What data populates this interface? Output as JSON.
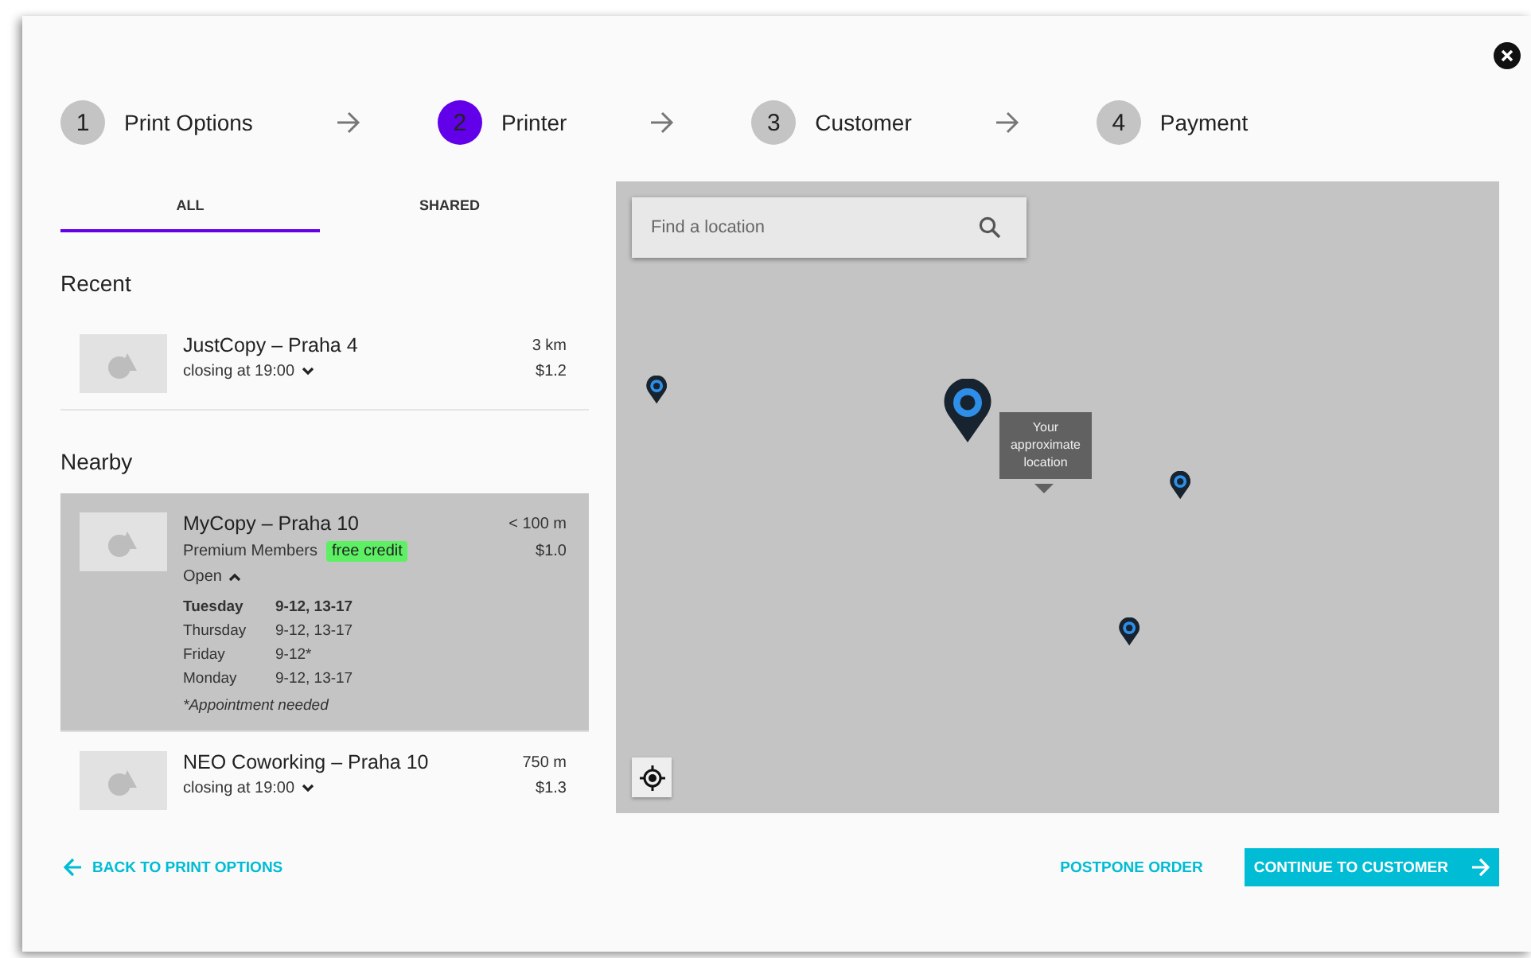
{
  "steps": [
    {
      "number": "1",
      "label": "Print Options",
      "selected": false
    },
    {
      "number": "2",
      "label": "Printer",
      "selected": true
    },
    {
      "number": "3",
      "label": "Customer",
      "selected": false
    },
    {
      "number": "4",
      "label": "Payment",
      "selected": false
    }
  ],
  "tabs": [
    {
      "label": "ALL",
      "selected": true
    },
    {
      "label": "SHARED",
      "selected": false
    }
  ],
  "sections": [
    {
      "title": "Recent",
      "printers": [
        {
          "name": "JustCopy – Praha 4",
          "hours": "closing at 19:00",
          "distance": "3 km",
          "price": "$1.2",
          "selected": false,
          "expanded": false
        }
      ]
    },
    {
      "title": "Nearby",
      "printers": [
        {
          "name": "MyCopy – Praha 10",
          "membership": "Premium Members",
          "badge": "free credit",
          "hours": "Open",
          "distance": "< 100 m",
          "price": "$1.0",
          "selected": true,
          "expanded": true,
          "schedule": [
            {
              "day": "Tuesday",
              "time": "9-12, 13-17",
              "today": true
            },
            {
              "day": "Thursday",
              "time": "9-12, 13-17",
              "today": false
            },
            {
              "day": "Friday",
              "time": "9-12*",
              "today": false
            },
            {
              "day": "Monday",
              "time": "9-12, 13-17",
              "today": false
            }
          ],
          "note": "*Appointment needed"
        },
        {
          "name": "NEO Coworking – Praha 10",
          "hours": "closing at 19:00",
          "distance": "750 m",
          "price": "$1.3",
          "selected": false,
          "expanded": false
        }
      ]
    }
  ],
  "map": {
    "search": {
      "placeholder": "Find a location"
    },
    "tooltip": "Your approximate location"
  },
  "footer": {
    "back": "BACK TO PRINT OPTIONS",
    "postpone": "POSTPONE ORDER",
    "continue": "CONTINUE TO CUSTOMER"
  }
}
